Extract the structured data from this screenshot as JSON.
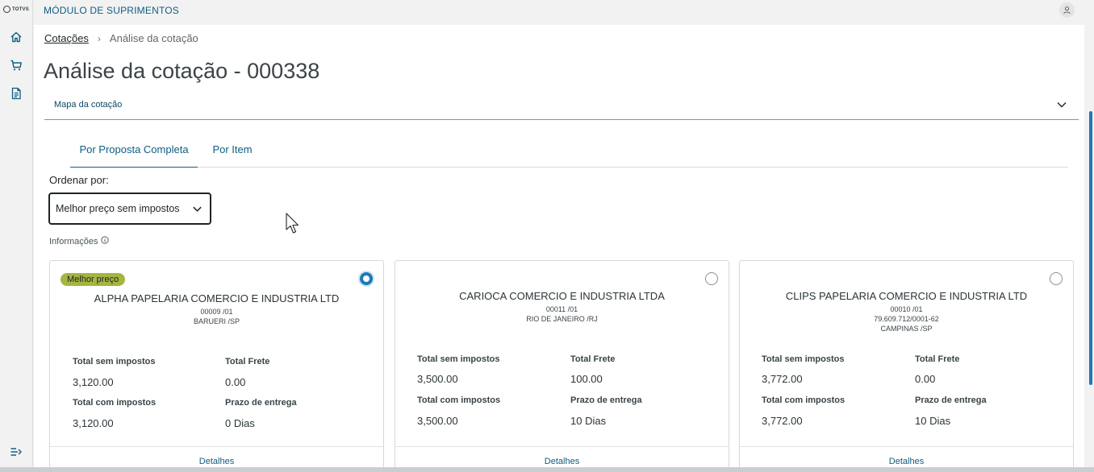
{
  "brand": {
    "logo_text": "TOTVS"
  },
  "header": {
    "module_title": "MÓDULO DE SUPRIMENTOS"
  },
  "breadcrumb": {
    "parent": "Cotações",
    "separator": "›",
    "current": "Análise da cotação"
  },
  "page": {
    "title": "Análise da cotação - 000338"
  },
  "accordion": {
    "label": "Mapa da cotação"
  },
  "tabs": [
    {
      "label": "Por Proposta Completa",
      "active": true
    },
    {
      "label": "Por Item",
      "active": false
    }
  ],
  "sort": {
    "label": "Ordenar por:",
    "selected": "Melhor preço sem impostos"
  },
  "info": {
    "label": "Informações"
  },
  "field_labels": {
    "total_sem": "Total sem impostos",
    "total_frete": "Total Frete",
    "total_com": "Total com impostos",
    "prazo": "Prazo de entrega"
  },
  "cards": [
    {
      "badge": "Melhor preço",
      "selected": true,
      "name": "ALPHA PAPELARIA COMERCIO E INDUSTRIA LTD",
      "code": "00009 /01",
      "doc": "",
      "city": "BARUERI /SP",
      "total_sem": "3,120.00",
      "total_frete": "0.00",
      "total_com": "3,120.00",
      "prazo": "0 Dias",
      "details": "Detalhes"
    },
    {
      "badge": "",
      "selected": false,
      "name": "CARIOCA COMERCIO E INDUSTRIA LTDA",
      "code": "00011 /01",
      "doc": "",
      "city": "RIO DE JANEIRO /RJ",
      "total_sem": "3,500.00",
      "total_frete": "100.00",
      "total_com": "3,500.00",
      "prazo": "10 Dias",
      "details": "Detalhes"
    },
    {
      "badge": "",
      "selected": false,
      "name": "CLIPS PAPELARIA COMERCIO E INDUSTRIA LTD",
      "code": "00010 /01",
      "doc": "79.609.712/0001-62",
      "city": "CAMPINAS /SP",
      "total_sem": "3,772.00",
      "total_frete": "0.00",
      "total_com": "3,772.00",
      "prazo": "10 Dias",
      "details": "Detalhes"
    }
  ],
  "colors": {
    "accent": "#0c5e82",
    "radio_selected": "#1c7ab8",
    "badge": "#a7b43f"
  },
  "icons": [
    "home-icon",
    "cart-icon",
    "document-icon",
    "collapse-menu-icon",
    "user-icon",
    "chevron-down-icon",
    "info-icon"
  ]
}
